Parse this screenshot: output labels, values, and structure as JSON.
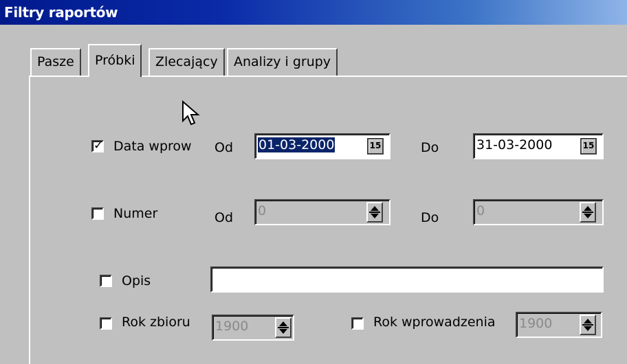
{
  "window": {
    "title": "Filtry raportów"
  },
  "tabs": [
    {
      "label": "Pasze"
    },
    {
      "label": "Próbki"
    },
    {
      "label": "Zlecający"
    },
    {
      "label": "Analizy i grupy"
    }
  ],
  "active_tab": "Próbki",
  "filters": {
    "data_wprow": {
      "label": "Data wprow",
      "checked": true,
      "od_label": "Od",
      "od_value": "01-03-2000",
      "do_label": "Do",
      "do_value": "31-03-2000",
      "calendar_icon": "15"
    },
    "numer": {
      "label": "Numer",
      "checked": false,
      "od_label": "Od",
      "od_value": "0",
      "do_label": "Do",
      "do_value": "0"
    },
    "opis": {
      "label": "Opis",
      "checked": false,
      "value": ""
    },
    "rok_zbioru": {
      "label": "Rok zbioru",
      "checked": false,
      "value": "1900"
    },
    "rok_wprowadzenia": {
      "label": "Rok wprowadzenia",
      "checked": false,
      "value": "1900"
    }
  },
  "colors": {
    "title_bar": "#0a2aa8",
    "selection": "#0a246a",
    "face": "#c0c0c0"
  },
  "icons": {
    "cursor": "arrow-cursor-icon",
    "checkmark": "checkmark-icon"
  }
}
